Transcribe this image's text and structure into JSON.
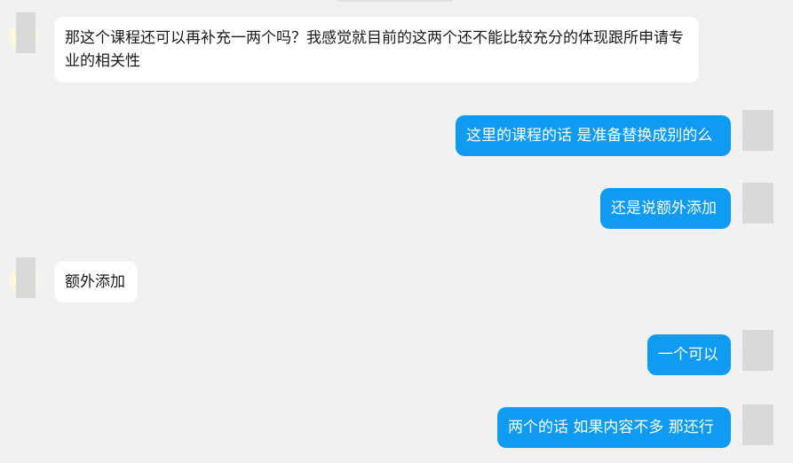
{
  "chat": {
    "messages": [
      {
        "direction": "in",
        "text": "那这个课程还可以再补充一两个吗？我感觉就目前的这两个还不能比较充分的体现跟所申请专业的相关性"
      },
      {
        "direction": "out",
        "text": "这里的课程的话 是准备替换成别的么"
      },
      {
        "direction": "out",
        "text": "还是说额外添加"
      },
      {
        "direction": "in",
        "text": "额外添加"
      },
      {
        "direction": "out",
        "text": "一个可以"
      },
      {
        "direction": "out",
        "text": "两个的话 如果内容不多 那还行"
      }
    ]
  },
  "colors": {
    "background": "#f1f1f1",
    "incoming_bubble": "#ffffff",
    "outgoing_bubble": "#0e9bf1",
    "avatar_placeholder": "#d9d9d9"
  }
}
